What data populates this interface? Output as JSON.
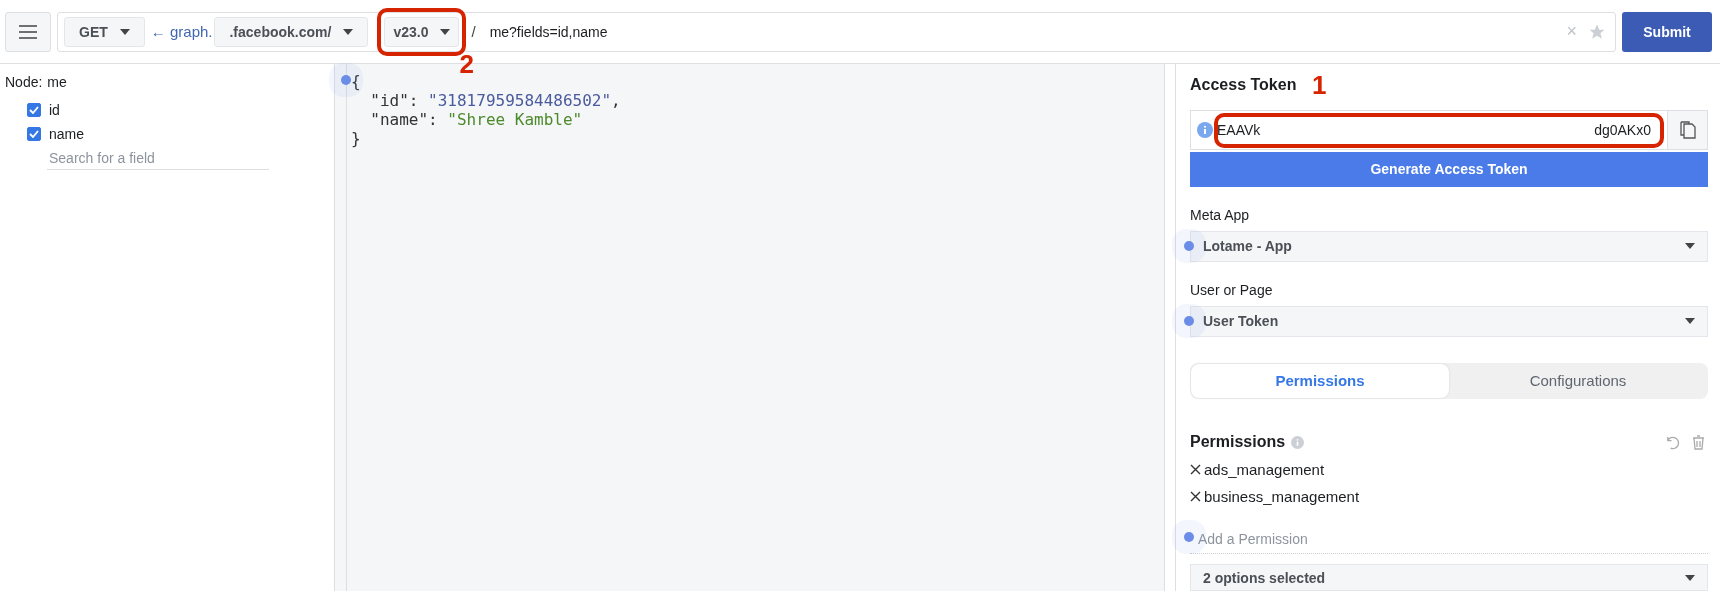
{
  "toolbar": {
    "method": "GET",
    "host_prefix": "← graph.",
    "host": ".facebook.com/",
    "version": "v23.0",
    "path_separator": "/",
    "path": "me?fields=id,name",
    "clear": "×",
    "submit": "Submit"
  },
  "fields_panel": {
    "node_label": "Node:",
    "node": "me",
    "search_placeholder": "Search for a field",
    "fields": [
      {
        "name": "id",
        "checked": true
      },
      {
        "name": "name",
        "checked": true
      }
    ]
  },
  "response": {
    "open": "{",
    "close": "}",
    "entries": [
      {
        "key": "\"id\"",
        "colon": ":",
        "value": "\"31817959584486502\"",
        "comma": ",",
        "color": "#4a5a9e"
      },
      {
        "key": "\"name\"",
        "colon": ":",
        "value": "\"Shree Kamble\"",
        "color": "#4d8a2c"
      }
    ]
  },
  "access_token": {
    "title": "Access Token",
    "token_start": "EAAVk",
    "token_end": "dg0AKx0",
    "generate": "Generate Access Token"
  },
  "meta_app": {
    "label": "Meta App",
    "value": "Lotame - App"
  },
  "user_or_page": {
    "label": "User or Page",
    "value": "User Token"
  },
  "tabs": [
    {
      "label": "Permissions",
      "selected": true
    },
    {
      "label": "Configurations",
      "selected": false
    }
  ],
  "permissions": {
    "title": "Permissions",
    "items": [
      "ads_management",
      "business_management"
    ],
    "add_placeholder": "Add a Permission",
    "summary": "2 options selected"
  },
  "version_annotation": {
    "number": "2"
  },
  "token_annotation": {
    "number": "1"
  }
}
